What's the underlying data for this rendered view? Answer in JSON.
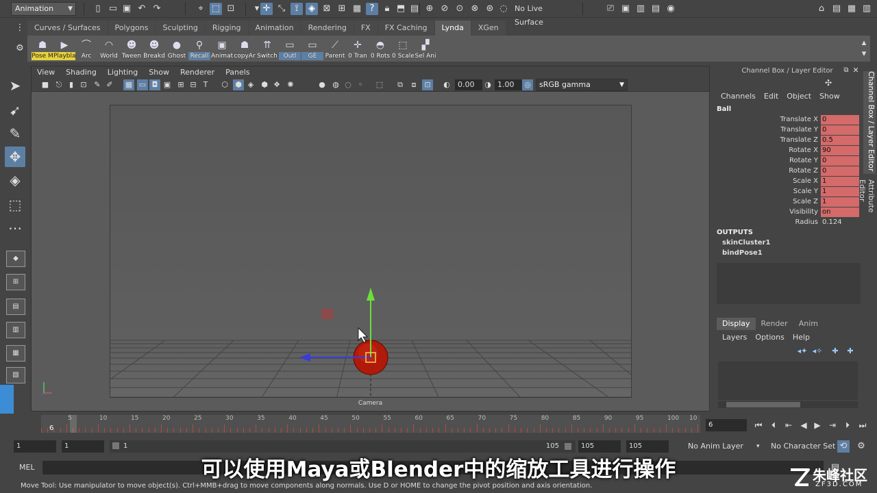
{
  "status_line": {
    "mode": "Animation",
    "live_surface": "No Live Surface"
  },
  "shelf_tabs": [
    "Curves / Surfaces",
    "Polygons",
    "Sculpting",
    "Rigging",
    "Animation",
    "Rendering",
    "FX",
    "FX Caching",
    "Lynda",
    "XGen"
  ],
  "shelf_tabs_active": "Lynda",
  "shelf_buttons": [
    "Pose M",
    "Playbla",
    "Arc",
    "World",
    "Tween",
    "Breakd",
    "Ghost",
    "Recall",
    "Animat",
    "copyAr",
    "Switch",
    "Outl",
    "GE",
    "Parent",
    "0 Tran",
    "0 Rots",
    "0 Scale",
    "Sel Ani"
  ],
  "viewport": {
    "menus": [
      "View",
      "Shading",
      "Lighting",
      "Show",
      "Renderer",
      "Panels"
    ],
    "exposure": "0.00",
    "gamma": "1.00",
    "color_space": "sRGB gamma",
    "camera_label": "Camera"
  },
  "channel_box": {
    "title": "Channel Box / Layer Editor",
    "menus": [
      "Channels",
      "Edit",
      "Object",
      "Show"
    ],
    "object_name": "Ball",
    "attributes": [
      {
        "name": "Translate X",
        "value": "0"
      },
      {
        "name": "Translate Y",
        "value": "0"
      },
      {
        "name": "Translate Z",
        "value": "0.5"
      },
      {
        "name": "Rotate X",
        "value": "90"
      },
      {
        "name": "Rotate Y",
        "value": "0"
      },
      {
        "name": "Rotate Z",
        "value": "0"
      },
      {
        "name": "Scale X",
        "value": "1"
      },
      {
        "name": "Scale Y",
        "value": "1"
      },
      {
        "name": "Scale Z",
        "value": "1"
      },
      {
        "name": "Visibility",
        "value": "on"
      },
      {
        "name": "Radius",
        "value": "0.124"
      }
    ],
    "outputs_label": "OUTPUTS",
    "outputs": [
      "skinCluster1",
      "bindPose1"
    ]
  },
  "side_tabs": [
    "Channel Box / Layer Editor",
    "Attribute Editor"
  ],
  "layer_editor": {
    "tabs": [
      "Display",
      "Render",
      "Anim"
    ],
    "menus": [
      "Layers",
      "Options",
      "Help"
    ]
  },
  "time_slider": {
    "tick_labels": [
      "5",
      "10",
      "15",
      "20",
      "25",
      "30",
      "35",
      "40",
      "45",
      "50",
      "55",
      "60",
      "65",
      "70",
      "75",
      "80",
      "85",
      "90",
      "95",
      "100",
      "10"
    ],
    "current_marker": "6",
    "current_frame": "6"
  },
  "range_slider": {
    "start": "1",
    "playback_start": "1",
    "range_label": "1",
    "range_end_label": "105",
    "playback_end": "105",
    "end": "105",
    "anim_layer": "No Anim Layer",
    "character_set": "No Character Set"
  },
  "command_line": {
    "label": "MEL"
  },
  "help_line": "Move Tool: Use manipulator to move object(s). Ctrl+MMB+drag to move components along normals. Use D or HOME to change the pivot position and axis orientation.",
  "subtitle": "可以使用Maya或Blender中的缩放工具进行操作",
  "watermark": {
    "name": "朱峰社区",
    "url": "ZF3D.COM"
  }
}
